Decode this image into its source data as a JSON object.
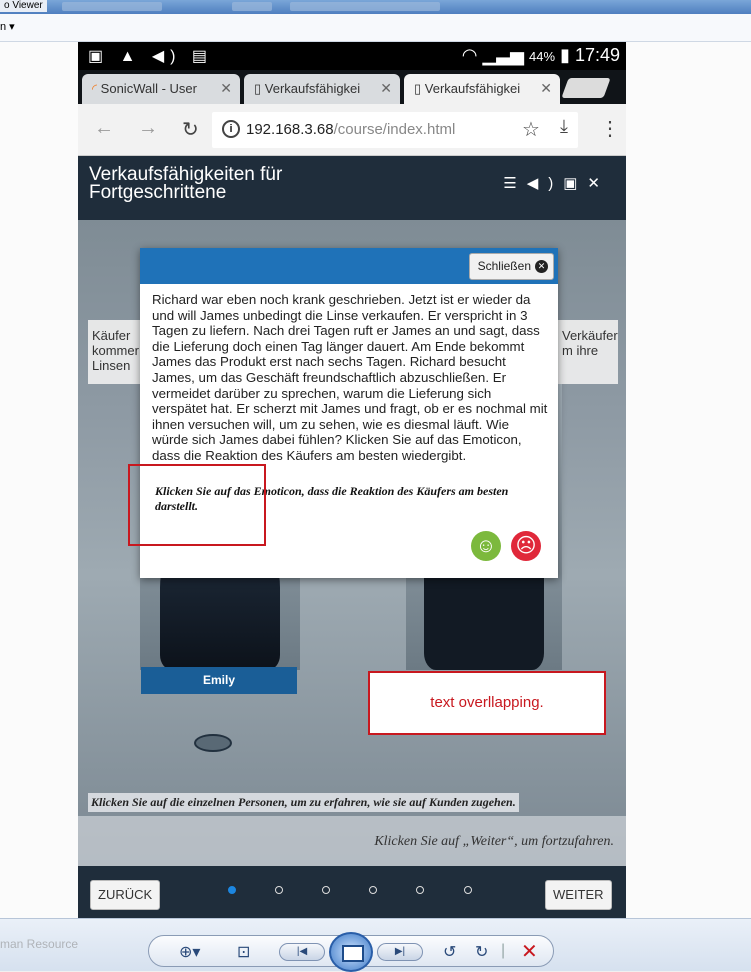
{
  "viewer": {
    "title": "o Viewer",
    "menu": "n ▾",
    "resource_text": "man Resource"
  },
  "phone": {
    "status": {
      "left_icons": "▣ ▲ ◀) ▤",
      "battery_pct": "44%",
      "time": "17:49"
    },
    "tabs": [
      {
        "label": "SonicWall - User",
        "close": "✕"
      },
      {
        "label": "Verkaufsfähigkei",
        "close": "✕"
      },
      {
        "label": "Verkaufsfähigkei",
        "close": "✕"
      }
    ],
    "url": {
      "host": "192.168.3.68",
      "path": "/course/index.html"
    },
    "course": {
      "title": "Verkaufsfähigkeiten für Fortgeschrittene",
      "icons": "☰ ◀) ▣ ✕"
    },
    "stage": {
      "left_box": "Käufer kommer Linsen",
      "right_box": "Verkäufer m ihre",
      "person_name": "Emily",
      "hint_people": "Klicken Sie auf die einzelnen Personen, um zu erfahren, wie sie auf Kunden zugehen.",
      "hint_next": "Klicken Sie auf „Weiter“, um fortzufahren."
    },
    "modal": {
      "close_label": "Schließen",
      "body": "Richard war eben noch krank geschrieben. Jetzt ist er wieder da und will James unbedingt die Linse verkaufen. Er verspricht in 3 Tagen zu liefern. Nach drei Tagen ruft er James an und sagt, dass die Lieferung doch einen Tag länger dauert. Am Ende bekommt James das Produkt erst nach sechs Tagen. Richard besucht James, um das Geschäft freundschaftlich abzuschließen. Er vermeidet darüber zu sprechen, warum die Lieferung sich verspätet hat. Er scherzt mit James und fragt, ob er es nochmal mit ihnen versuchen will, um zu sehen, wie es diesmal läuft. Wie würde sich James dabei fühlen? Klicken Sie auf das Emoticon, dass die Reaktion des Käufers am besten wiedergibt.",
      "instruction": "Klicken Sie auf das Emoticon, dass die Reaktion des Käufers am besten darstellt."
    },
    "footer": {
      "back_label": "ZURÜCK",
      "next_label": "WEITER"
    }
  },
  "annotation": {
    "text": "text overllapping."
  },
  "colors": {
    "header": "#1f2d3b",
    "modal_header": "#1f72b8",
    "annotation": "#c8181f",
    "happy": "#7cb93d",
    "sad": "#e0283a",
    "dot_active": "#1c86e0"
  }
}
